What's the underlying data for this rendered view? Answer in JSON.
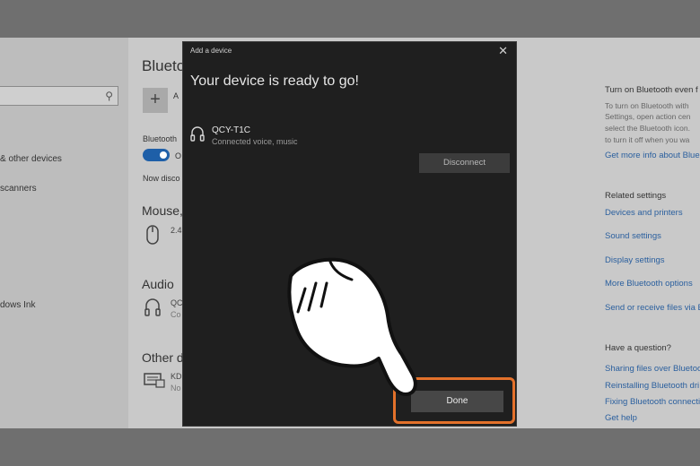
{
  "left_nav": {
    "search_icon": "search-icon",
    "items": [
      "& other devices",
      "scanners",
      "dows Ink"
    ]
  },
  "main": {
    "title": "Blueto",
    "add_icon": "plus-icon",
    "add_label": "A",
    "bluetooth_label": "Bluetooth",
    "toggle_state": "O",
    "now_discoverable": "Now disco",
    "mouse_section": "Mouse,",
    "mouse_item": "2.4",
    "audio_section": "Audio",
    "audio_item_name": "QC",
    "audio_item_status": "Co",
    "other_section": "Other d",
    "other_item_name": "KD",
    "other_item_status": "No"
  },
  "right_panel": {
    "heading": "Turn on Bluetooth even f",
    "paragraph": [
      "To turn on Bluetooth with",
      "Settings, open action cen",
      "select the Bluetooth icon.",
      "to turn it off when you wa"
    ],
    "more_info_link": "Get more info about Blue",
    "related_heading": "Related settings",
    "related_links": [
      "Devices and printers",
      "Sound settings",
      "Display settings",
      "More Bluetooth options",
      "Send or receive files via B"
    ],
    "question_heading": "Have a question?",
    "help_links": [
      "Sharing files over Bluetoo",
      "Reinstalling Bluetooth dri",
      "Fixing Bluetooth connecti",
      "Get help"
    ]
  },
  "dialog": {
    "title": "Add a device",
    "close_icon": "close-icon",
    "heading": "Your device is ready to go!",
    "device_icon": "headphones-icon",
    "device_name": "QCY-T1C",
    "device_status": "Connected voice, music",
    "disconnect_label": "Disconnect",
    "done_label": "Done",
    "highlight_color": "#e3712b"
  },
  "overlay": {
    "pointer_icon": "pointing-hand-icon"
  }
}
